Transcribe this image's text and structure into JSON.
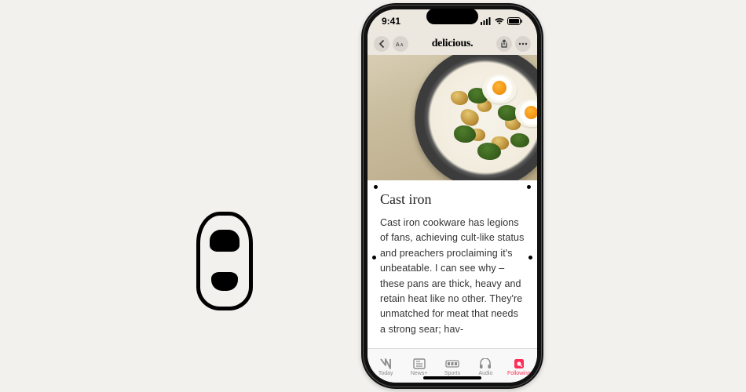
{
  "status": {
    "time": "9:41"
  },
  "nav": {
    "brand": "delicious."
  },
  "article": {
    "title": "Cast iron",
    "body": "Cast iron cookware has legions of fans, achieving cult-like status and preachers proclaiming it's unbeatable. I can see why – these pans are thick, heavy and retain heat like no other. They're unmatched for meat that needs a strong sear; hav-"
  },
  "tabs": [
    {
      "label": "Today",
      "icon": "news-icon",
      "active": false
    },
    {
      "label": "News+",
      "icon": "newsplus-icon",
      "active": false
    },
    {
      "label": "Sports",
      "icon": "sports-icon",
      "active": false
    },
    {
      "label": "Audio",
      "icon": "audio-icon",
      "active": false
    },
    {
      "label": "Following",
      "icon": "following-icon",
      "active": true
    }
  ]
}
